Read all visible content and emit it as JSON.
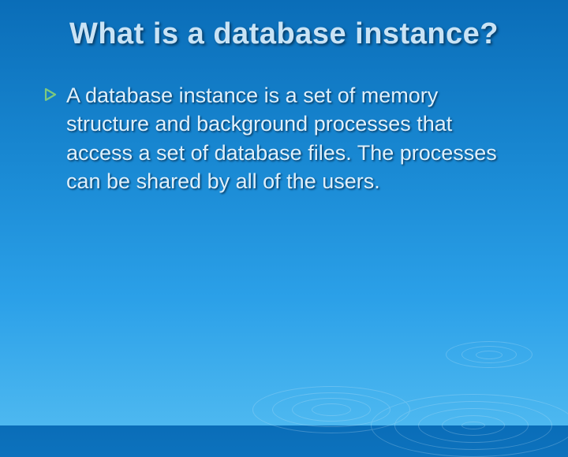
{
  "slide": {
    "title": "What is a database instance?",
    "bullets": [
      "A database instance is a set of memory structure and background processes that access a set of database files. The processes can be shared by all of the users."
    ]
  }
}
